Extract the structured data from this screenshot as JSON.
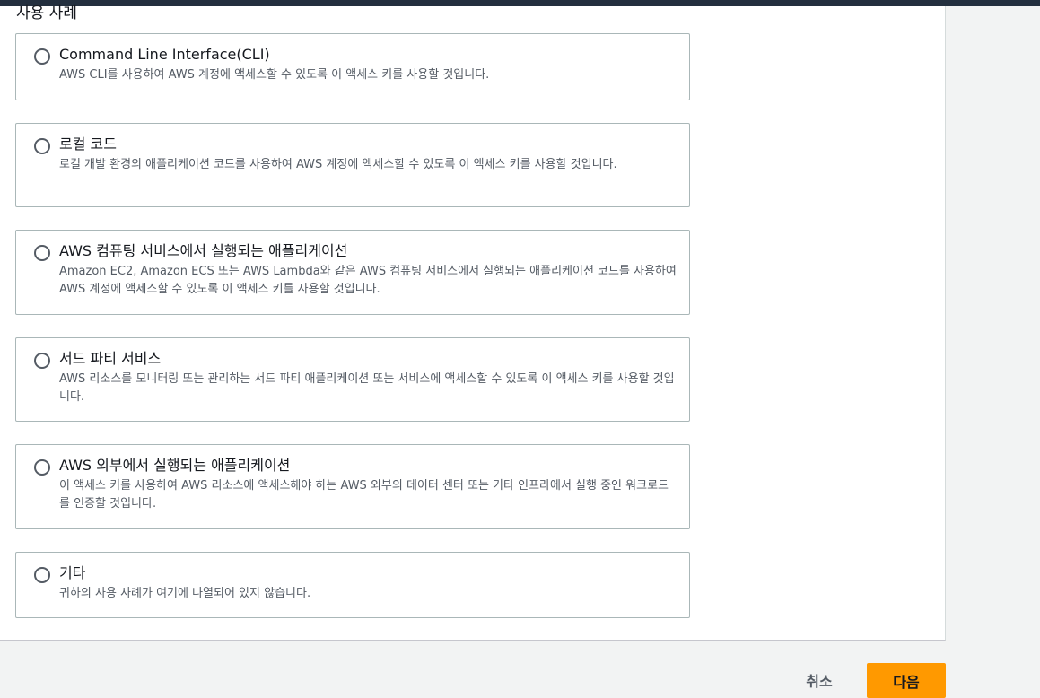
{
  "section": {
    "title": "사용 사례"
  },
  "options": [
    {
      "title": "Command Line Interface(CLI)",
      "description": "AWS CLI를 사용하여 AWS 계정에 액세스할 수 있도록 이 액세스 키를 사용할 것입니다."
    },
    {
      "title": "로컬 코드",
      "description": "로컬 개발 환경의 애플리케이션 코드를 사용하여 AWS 계정에 액세스할 수 있도록 이 액세스 키를 사용할 것입니다."
    },
    {
      "title": "AWS 컴퓨팅 서비스에서 실행되는 애플리케이션",
      "description": "Amazon EC2, Amazon ECS 또는 AWS Lambda와 같은 AWS 컴퓨팅 서비스에서 실행되는 애플리케이션 코드를 사용하여 AWS 계정에 액세스할 수 있도록 이 액세스 키를 사용할 것입니다."
    },
    {
      "title": "서드 파티 서비스",
      "description": "AWS 리소스를 모니터링 또는 관리하는 서드 파티 애플리케이션 또는 서비스에 액세스할 수 있도록 이 액세스 키를 사용할 것입니다."
    },
    {
      "title": "AWS 외부에서 실행되는 애플리케이션",
      "description": "이 액세스 키를 사용하여 AWS 리소스에 액세스해야 하는 AWS 외부의 데이터 센터 또는 기타 인프라에서 실행 중인 워크로드를 인증할 것입니다."
    },
    {
      "title": "기타",
      "description": "귀하의 사용 사례가 여기에 나열되어 있지 않습니다."
    }
  ],
  "footer": {
    "cancel_label": "취소",
    "next_label": "다음"
  },
  "colors": {
    "accent": "#ff9900",
    "header": "#232f3e"
  }
}
